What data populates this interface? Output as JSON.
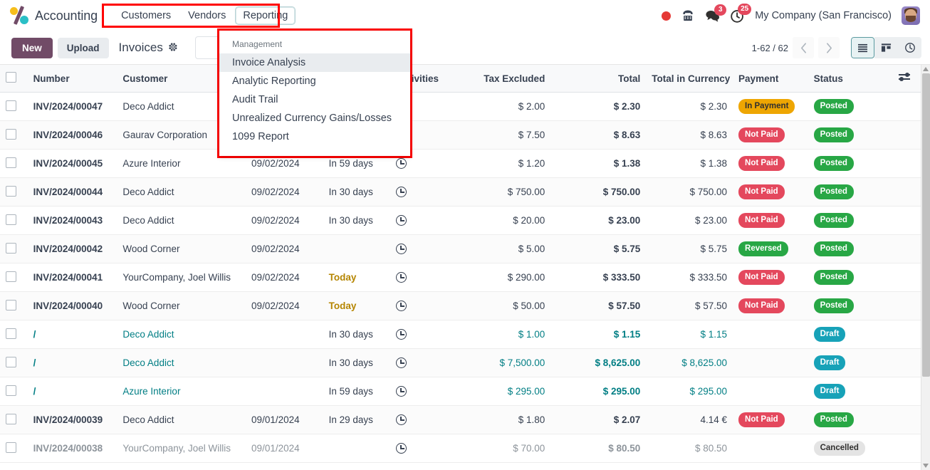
{
  "navbar": {
    "brand": "Accounting",
    "logo_icon": "odoo-logo",
    "menu": [
      {
        "label": "Customers",
        "active": false
      },
      {
        "label": "Vendors",
        "active": false
      },
      {
        "label": "Reporting",
        "active": true
      }
    ],
    "tray": {
      "record_icon": "record-dot-icon",
      "phone_icon": "phone-icon",
      "messages_icon": "messages-icon",
      "messages_count": "3",
      "activities_icon": "activities-clock-icon",
      "activities_count": "25"
    },
    "company": "My Company (San Francisco)",
    "avatar_icon": "user-avatar"
  },
  "control_panel": {
    "new_label": "New",
    "upload_label": "Upload",
    "breadcrumb": "Invoices",
    "gear_icon": "gear-icon",
    "search": {
      "value": "",
      "placeholder": ""
    },
    "search_caret_icon": "chevron-down-icon",
    "pager": "1-62 / 62",
    "prev_icon": "chevron-left-icon",
    "next_icon": "chevron-right-icon",
    "views": [
      {
        "icon": "list-view-icon",
        "active": true
      },
      {
        "icon": "kanban-view-icon",
        "active": false
      },
      {
        "icon": "activity-view-icon",
        "active": false
      }
    ]
  },
  "dropdown": {
    "section_label": "Management",
    "items": [
      {
        "label": "Invoice Analysis",
        "hover": true
      },
      {
        "label": "Analytic Reporting",
        "hover": false
      },
      {
        "label": "Audit Trail",
        "hover": false
      },
      {
        "label": "Unrealized Currency Gains/Losses",
        "hover": false
      },
      {
        "label": "1099 Report",
        "hover": false
      }
    ]
  },
  "table": {
    "headers": {
      "select": "",
      "number": "Number",
      "customer": "Customer",
      "invoice_date": "",
      "due_date": "",
      "activities": "Activities",
      "tax_excluded": "Tax Excluded",
      "total": "Total",
      "total_in_currency": "Total in Currency",
      "payment": "Payment",
      "status": "Status",
      "options_icon": "column-options-icon"
    },
    "rows": [
      {
        "number": "INV/2024/00047",
        "customer": "Deco Addict",
        "invoice_date": "",
        "due_date": "",
        "due_style": "normal",
        "activity_icon": "clock-icon",
        "tax_excluded": "$ 2.00",
        "total": "$ 2.30",
        "total_in_currency": "$ 2.30",
        "payment": "In Payment",
        "payment_style": "warning",
        "status": "Posted",
        "status_style": "success",
        "link_style": false
      },
      {
        "number": "INV/2024/00046",
        "customer": "Gaurav Corporation",
        "invoice_date": "",
        "due_date": "",
        "due_style": "normal",
        "activity_icon": "clock-icon",
        "tax_excluded": "$ 7.50",
        "total": "$ 8.63",
        "total_in_currency": "$ 8.63",
        "payment": "Not Paid",
        "payment_style": "danger",
        "status": "Posted",
        "status_style": "success",
        "link_style": false
      },
      {
        "number": "INV/2024/00045",
        "customer": "Azure Interior",
        "invoice_date": "09/02/2024",
        "due_date": "In 59 days",
        "due_style": "normal",
        "activity_icon": "clock-icon",
        "tax_excluded": "$ 1.20",
        "total": "$ 1.38",
        "total_in_currency": "$ 1.38",
        "payment": "Not Paid",
        "payment_style": "danger",
        "status": "Posted",
        "status_style": "success",
        "link_style": false
      },
      {
        "number": "INV/2024/00044",
        "customer": "Deco Addict",
        "invoice_date": "09/02/2024",
        "due_date": "In 30 days",
        "due_style": "normal",
        "activity_icon": "clock-icon",
        "tax_excluded": "$ 750.00",
        "total": "$ 750.00",
        "total_in_currency": "$ 750.00",
        "payment": "Not Paid",
        "payment_style": "danger",
        "status": "Posted",
        "status_style": "success",
        "link_style": false
      },
      {
        "number": "INV/2024/00043",
        "customer": "Deco Addict",
        "invoice_date": "09/02/2024",
        "due_date": "In 30 days",
        "due_style": "normal",
        "activity_icon": "clock-icon",
        "tax_excluded": "$ 20.00",
        "total": "$ 23.00",
        "total_in_currency": "$ 23.00",
        "payment": "Not Paid",
        "payment_style": "danger",
        "status": "Posted",
        "status_style": "success",
        "link_style": false
      },
      {
        "number": "INV/2024/00042",
        "customer": "Wood Corner",
        "invoice_date": "09/02/2024",
        "due_date": "",
        "due_style": "normal",
        "activity_icon": "clock-icon",
        "tax_excluded": "$ 5.00",
        "total": "$ 5.75",
        "total_in_currency": "$ 5.75",
        "payment": "Reversed",
        "payment_style": "success",
        "status": "Posted",
        "status_style": "success",
        "link_style": false
      },
      {
        "number": "INV/2024/00041",
        "customer": "YourCompany, Joel Willis",
        "invoice_date": "09/02/2024",
        "due_date": "Today",
        "due_style": "today",
        "activity_icon": "clock-icon",
        "tax_excluded": "$ 290.00",
        "total": "$ 333.50",
        "total_in_currency": "$ 333.50",
        "payment": "Not Paid",
        "payment_style": "danger",
        "status": "Posted",
        "status_style": "success",
        "link_style": false
      },
      {
        "number": "INV/2024/00040",
        "customer": "Wood Corner",
        "invoice_date": "09/02/2024",
        "due_date": "Today",
        "due_style": "today",
        "activity_icon": "clock-icon",
        "tax_excluded": "$ 50.00",
        "total": "$ 57.50",
        "total_in_currency": "$ 57.50",
        "payment": "Not Paid",
        "payment_style": "danger",
        "status": "Posted",
        "status_style": "success",
        "link_style": false
      },
      {
        "number": "/",
        "customer": "Deco Addict",
        "invoice_date": "",
        "due_date": "In 30 days",
        "due_style": "normal",
        "activity_icon": "clock-icon",
        "tax_excluded": "$ 1.00",
        "total": "$ 1.15",
        "total_in_currency": "$ 1.15",
        "payment": "",
        "payment_style": "none",
        "status": "Draft",
        "status_style": "info",
        "link_style": true
      },
      {
        "number": "/",
        "customer": "Deco Addict",
        "invoice_date": "",
        "due_date": "In 30 days",
        "due_style": "normal",
        "activity_icon": "clock-icon",
        "tax_excluded": "$ 7,500.00",
        "total": "$ 8,625.00",
        "total_in_currency": "$ 8,625.00",
        "payment": "",
        "payment_style": "none",
        "status": "Draft",
        "status_style": "info",
        "link_style": true
      },
      {
        "number": "/",
        "customer": "Azure Interior",
        "invoice_date": "",
        "due_date": "In 59 days",
        "due_style": "normal",
        "activity_icon": "clock-icon",
        "tax_excluded": "$ 295.00",
        "total": "$ 295.00",
        "total_in_currency": "$ 295.00",
        "payment": "",
        "payment_style": "none",
        "status": "Draft",
        "status_style": "info",
        "link_style": true
      },
      {
        "number": "INV/2024/00039",
        "customer": "Deco Addict",
        "invoice_date": "09/01/2024",
        "due_date": "In 29 days",
        "due_style": "normal",
        "activity_icon": "clock-icon",
        "tax_excluded": "$ 1.80",
        "total": "$ 2.07",
        "total_in_currency": "4.14 €",
        "payment": "Not Paid",
        "payment_style": "danger",
        "status": "Posted",
        "status_style": "success",
        "link_style": false
      },
      {
        "number": "INV/2024/00038",
        "customer": "YourCompany, Joel Willis",
        "invoice_date": "09/01/2024",
        "due_date": "",
        "due_style": "normal",
        "activity_icon": "clock-icon",
        "tax_excluded": "$ 70.00",
        "total": "$ 80.50",
        "total_in_currency": "$ 80.50",
        "payment": "",
        "payment_style": "none",
        "status": "Cancelled",
        "status_style": "default",
        "link_style": false,
        "muted": true
      }
    ]
  },
  "colors": {
    "brand_purple": "#714b67",
    "highlight_red": "#ff0000",
    "accent_teal": "#017e84",
    "badge_warning": "#eea602",
    "badge_danger": "#e4485d",
    "badge_success": "#28a745",
    "badge_info": "#17a2b8"
  }
}
